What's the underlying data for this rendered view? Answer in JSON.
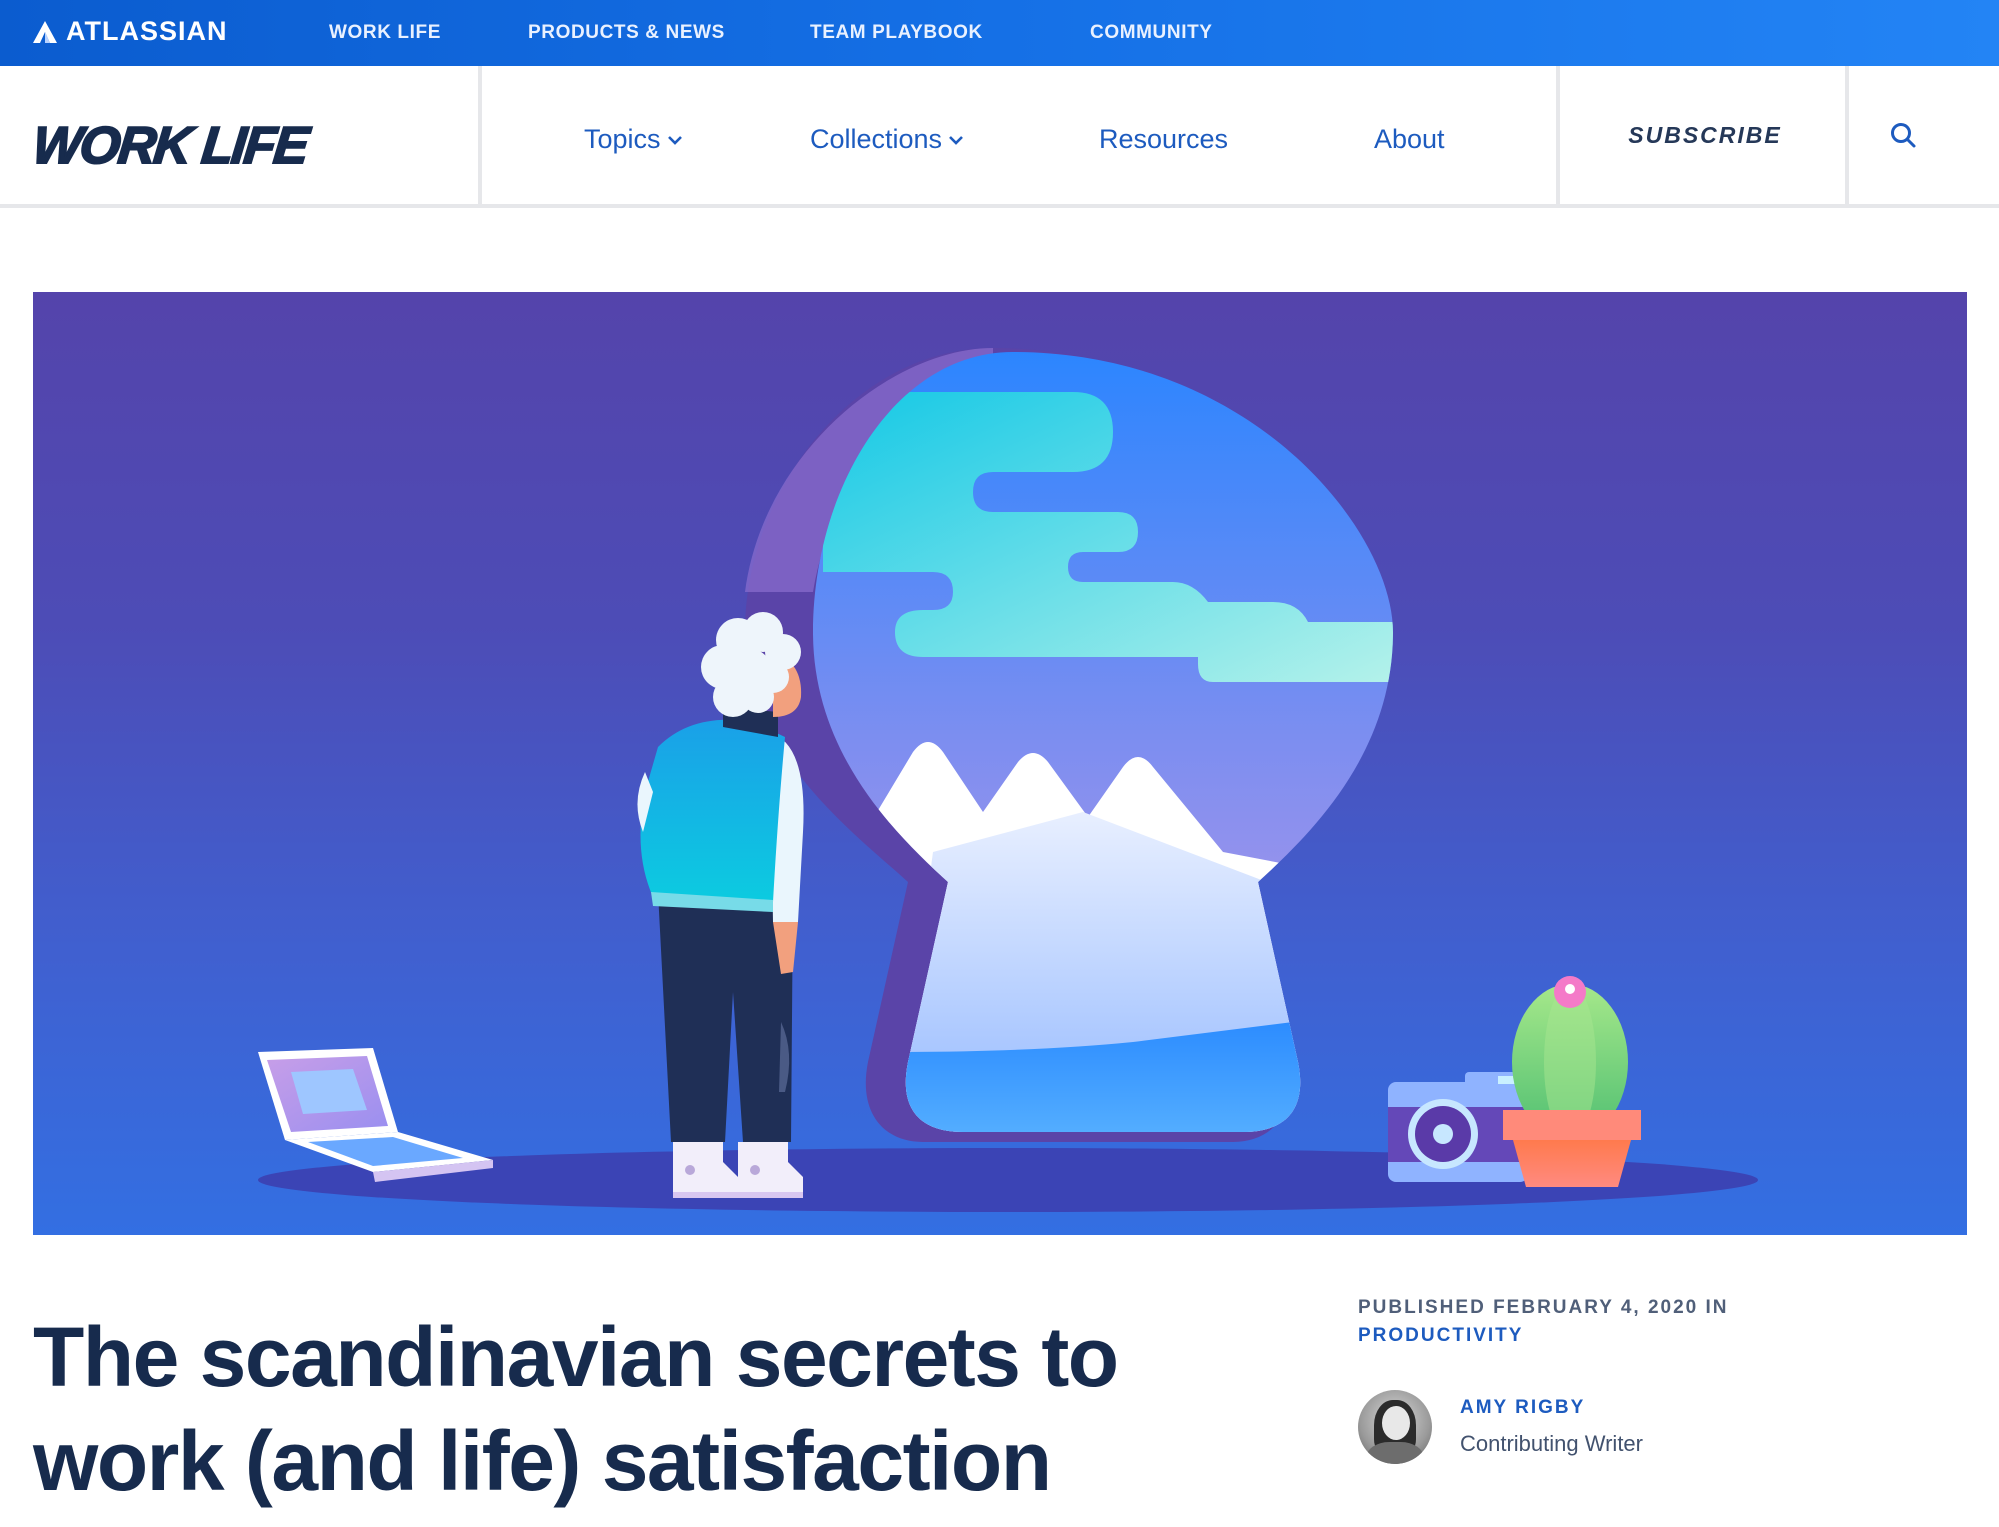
{
  "topbar": {
    "brand": "ATLASSIAN",
    "nav": [
      "WORK LIFE",
      "PRODUCTS & NEWS",
      "TEAM PLAYBOOK",
      "COMMUNITY"
    ]
  },
  "header": {
    "logo": "WORK LIFE",
    "nav": [
      {
        "label": "Topics",
        "has_dropdown": true
      },
      {
        "label": "Collections",
        "has_dropdown": true
      },
      {
        "label": "Resources",
        "has_dropdown": false
      },
      {
        "label": "About",
        "has_dropdown": false
      }
    ],
    "subscribe_label": "SUBSCRIBE",
    "search_icon": "search-icon",
    "chevron_glyph": "⌄"
  },
  "hero": {
    "illustration": "Person with white hair looking through a giant keyhole at sky, clouds and snowy mountains; laptop on the left, camera and potted cactus on the right",
    "colors": {
      "bg_top": "#5444ab",
      "bg_bottom": "#336fe2"
    }
  },
  "article": {
    "title_line1": "The scandinavian secrets to",
    "title_line2": "work (and life) satisfaction",
    "published": "PUBLISHED FEBRUARY 4, 2020 IN",
    "category": "PRODUCTIVITY",
    "author": {
      "name": "AMY RIGBY",
      "role": "Contributing Writer"
    }
  },
  "colors": {
    "brand_blue": "#0b5ccf",
    "link_blue": "#1d5bbf",
    "heading": "#172b4d",
    "muted": "#505f79"
  }
}
